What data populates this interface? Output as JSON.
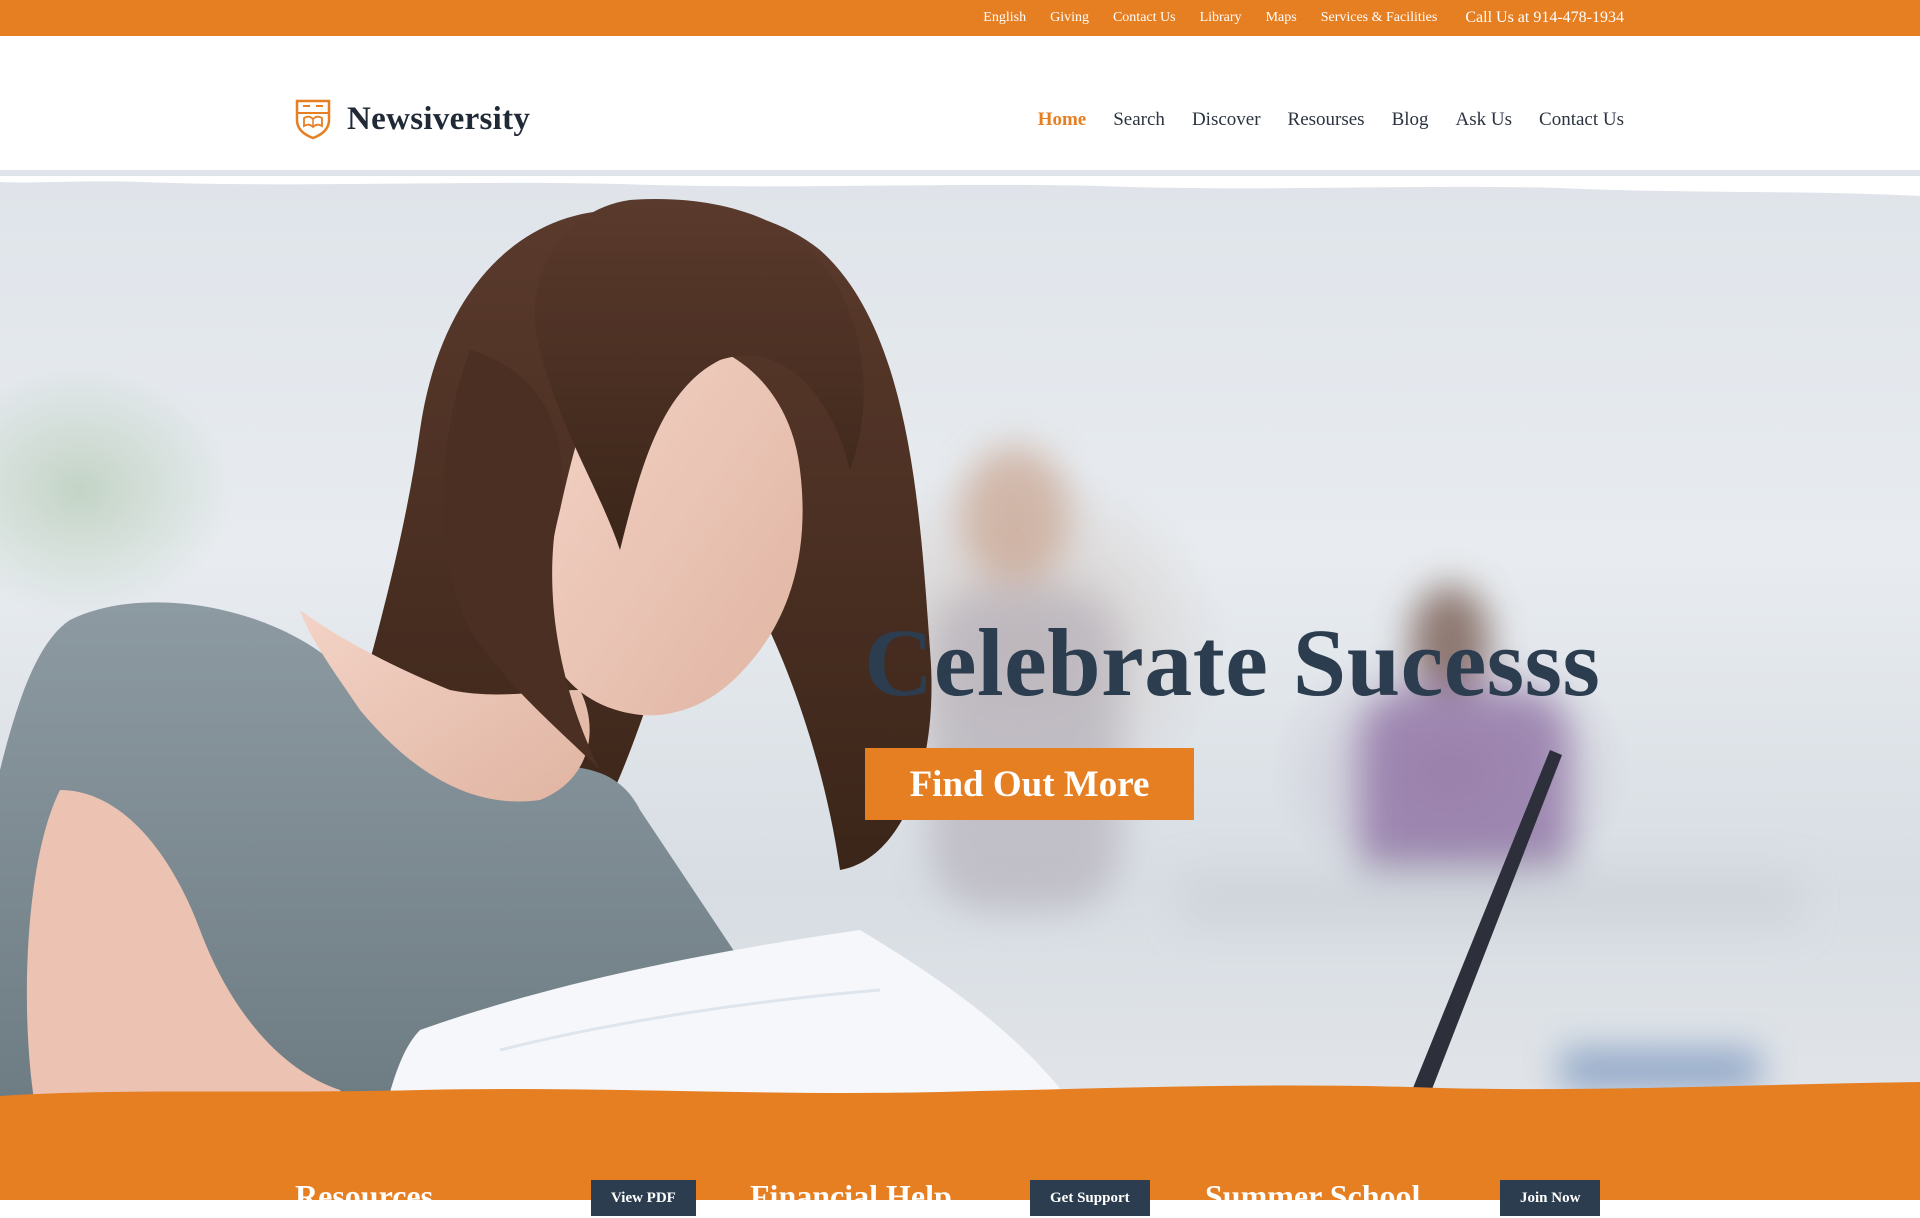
{
  "topbar": {
    "links": [
      "English",
      "Giving",
      "Contact Us",
      "Library",
      "Maps",
      "Services & Facilities"
    ],
    "phone": "Call Us at 914-478-1934"
  },
  "brand": {
    "name": "Newsiversity",
    "logo_icon": "shield-crest-icon"
  },
  "nav": {
    "items": [
      "Home",
      "Search",
      "Discover",
      "Resourses",
      "Blog",
      "Ask Us",
      "Contact Us"
    ],
    "active": "Home"
  },
  "hero": {
    "title": "Celebrate Sucesss",
    "button": "Find Out More"
  },
  "features": [
    {
      "title": "Resources",
      "button": "View PDF"
    },
    {
      "title": "Financial Help",
      "button": "Get Support"
    },
    {
      "title": "Summer School",
      "button": "Join Now"
    }
  ],
  "colors": {
    "accent": "#e67e22",
    "dark": "#2b3d4f",
    "white": "#ffffff"
  }
}
